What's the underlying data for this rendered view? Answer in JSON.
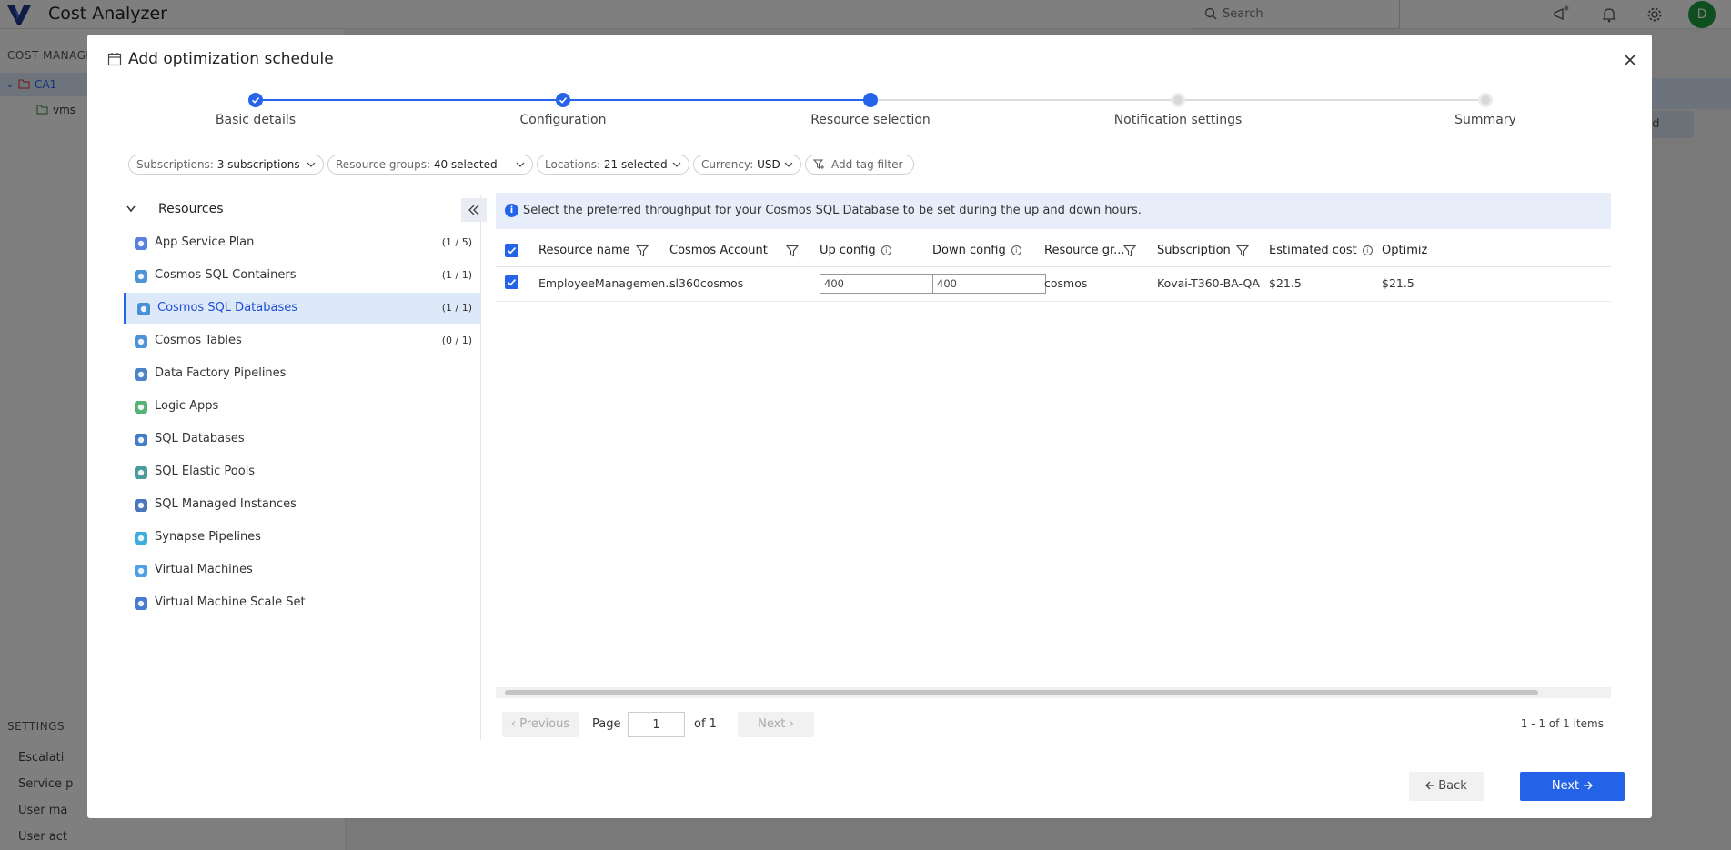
{
  "app": {
    "title": "Cost Analyzer",
    "search_placeholder": "Search",
    "avatar_initial": "D"
  },
  "sidebar": {
    "section": "COST MANAGE",
    "tree": [
      {
        "label": "CA1"
      },
      {
        "label": "vms"
      }
    ],
    "settings_section": "SETTINGS",
    "settings_items": [
      "Escalati",
      "Service p",
      "User ma",
      "User act"
    ]
  },
  "background": {
    "add_label": "dd"
  },
  "modal": {
    "title": "Add optimization schedule",
    "steps": [
      {
        "label": "Basic details",
        "state": "done"
      },
      {
        "label": "Configuration",
        "state": "done"
      },
      {
        "label": "Resource selection",
        "state": "active"
      },
      {
        "label": "Notification settings",
        "state": "todo"
      },
      {
        "label": "Summary",
        "state": "todo"
      }
    ],
    "filters": [
      {
        "key": "Subscriptions:",
        "value": "3 subscriptions"
      },
      {
        "key": "Resource groups:",
        "value": "40 selected"
      },
      {
        "key": "Locations:",
        "value": "21 selected"
      },
      {
        "key": "Currency:",
        "value": "USD"
      },
      {
        "key": "",
        "value": "Add tag filter"
      }
    ],
    "resources_header": "Resources",
    "resources": [
      {
        "name": "App Service Plan",
        "count": "(1 / 5)",
        "icon": "app-service-plan-icon"
      },
      {
        "name": "Cosmos SQL Containers",
        "count": "(1 / 1)",
        "icon": "cosmos-icon"
      },
      {
        "name": "Cosmos SQL Databases",
        "count": "(1 / 1)",
        "icon": "cosmos-icon",
        "selected": true
      },
      {
        "name": "Cosmos Tables",
        "count": "(0 / 1)",
        "icon": "cosmos-icon"
      },
      {
        "name": "Data Factory Pipelines",
        "count": "",
        "icon": "data-factory-icon"
      },
      {
        "name": "Logic Apps",
        "count": "",
        "icon": "logic-apps-icon"
      },
      {
        "name": "SQL Databases",
        "count": "",
        "icon": "sql-database-icon"
      },
      {
        "name": "SQL Elastic Pools",
        "count": "",
        "icon": "sql-elastic-pool-icon"
      },
      {
        "name": "SQL Managed Instances",
        "count": "",
        "icon": "sql-managed-instance-icon"
      },
      {
        "name": "Synapse Pipelines",
        "count": "",
        "icon": "synapse-icon"
      },
      {
        "name": "Virtual Machines",
        "count": "",
        "icon": "virtual-machine-icon"
      },
      {
        "name": "Virtual Machine Scale Set",
        "count": "",
        "icon": "vmss-icon"
      }
    ],
    "info_text": "Select the preferred throughput for your Cosmos SQL Database to be set during the up and down hours.",
    "columns": {
      "resource_name": "Resource name",
      "cosmos_account": "Cosmos Account",
      "up_config": "Up config",
      "down_config": "Down config",
      "resource_group": "Resource gr...",
      "subscription": "Subscription",
      "estimated_cost": "Estimated cost",
      "optimized": "Optimiz"
    },
    "rows": [
      {
        "resource_name": "EmployeeManagemen...",
        "cosmos_account": "sl360cosmos",
        "up_config": "400",
        "down_config": "400",
        "resource_group": "cosmos",
        "subscription": "Kovai-T360-BA-QA",
        "estimated_cost": "$21.5",
        "optimized": "$21.5"
      }
    ],
    "pager": {
      "previous": "Previous",
      "page_label": "Page",
      "page_value": "1",
      "of_label": "of 1",
      "next": "Next",
      "summary": "1 - 1 of 1 items"
    },
    "back_label": "Back",
    "next_label": "Next"
  },
  "colors": {
    "accent": "#2463e8",
    "selected_bg": "#dde8f9",
    "avatar": "#1e9e3e"
  }
}
